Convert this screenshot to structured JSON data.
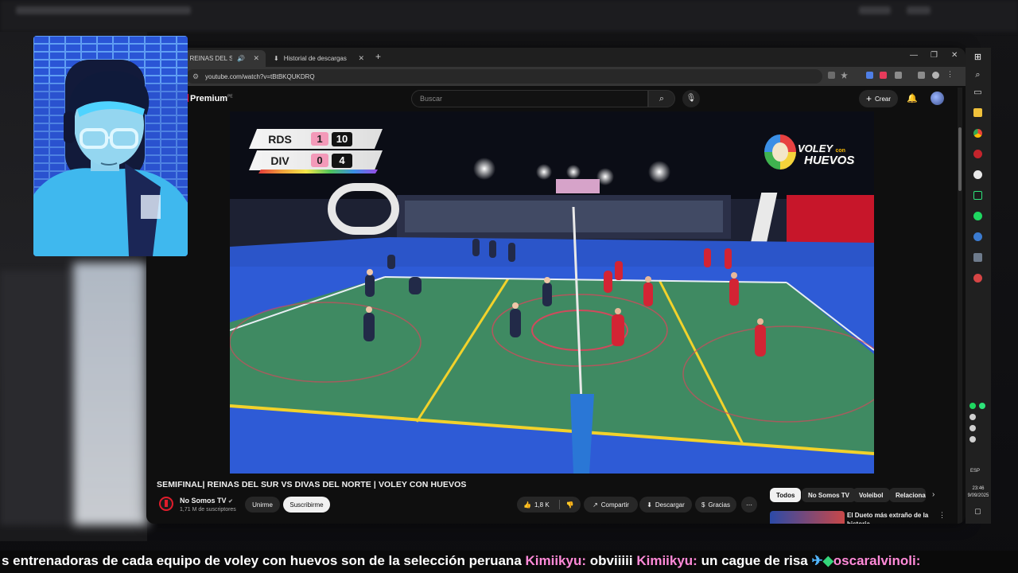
{
  "browser": {
    "tabs": [
      {
        "label": "SEMIFINAL| REINAS DEL SUR",
        "active": true
      },
      {
        "label": "Historial de descargas",
        "active": false
      }
    ],
    "url": "youtube.com/watch?v=tBtBKQUKDRQ"
  },
  "youtube": {
    "brand": "Premium",
    "region": "PE",
    "search_placeholder": "Buscar",
    "create_label": "Crear",
    "video": {
      "title": "SEMIFINAL| REINAS DEL SUR VS DIVAS DEL NORTE | VOLEY CON HUEVOS",
      "scoreboard": {
        "rows": [
          {
            "team": "RDS",
            "sets": "1",
            "points": "10"
          },
          {
            "team": "DIV",
            "sets": "0",
            "points": "4"
          }
        ]
      },
      "broadcast_logo": {
        "line1": "VOLEY",
        "small": "con",
        "line2": "HUEVOS"
      }
    },
    "channel": {
      "name": "No Somos TV",
      "subscribers": "1,71 M de suscriptores",
      "join_label": "Unirme",
      "subscribe_label": "Suscribirme"
    },
    "actions": {
      "likes": "1,8 K",
      "share": "Compartir",
      "download": "Descargar",
      "thanks": "Gracias"
    },
    "chips": [
      "Todos",
      "No Somos TV",
      "Voleibol",
      "Relaciona"
    ],
    "recommendation": {
      "title": "El Dueto más extraño de la historia"
    }
  },
  "system_tray": {
    "language": "ESP",
    "time": "23:46",
    "date": "9/09/2025"
  },
  "chat_ticker": {
    "segments": [
      {
        "type": "text",
        "text": "s entrenadoras de cada equipo de voley con huevos son de la selección peruana "
      },
      {
        "type": "user",
        "text": "Kimiikyu:"
      },
      {
        "type": "text",
        "text": " obviiiii "
      },
      {
        "type": "user",
        "text": "Kimiikyu:"
      },
      {
        "type": "text",
        "text": " un cague de risa "
      },
      {
        "type": "user",
        "text": "oscaralvinoli:"
      }
    ]
  },
  "colors": {
    "yt_red": "#ff0033",
    "court_green": "#3f8a62",
    "court_blue": "#2e5bd6",
    "team_red": "#d32434",
    "team_navy": "#222a48"
  }
}
